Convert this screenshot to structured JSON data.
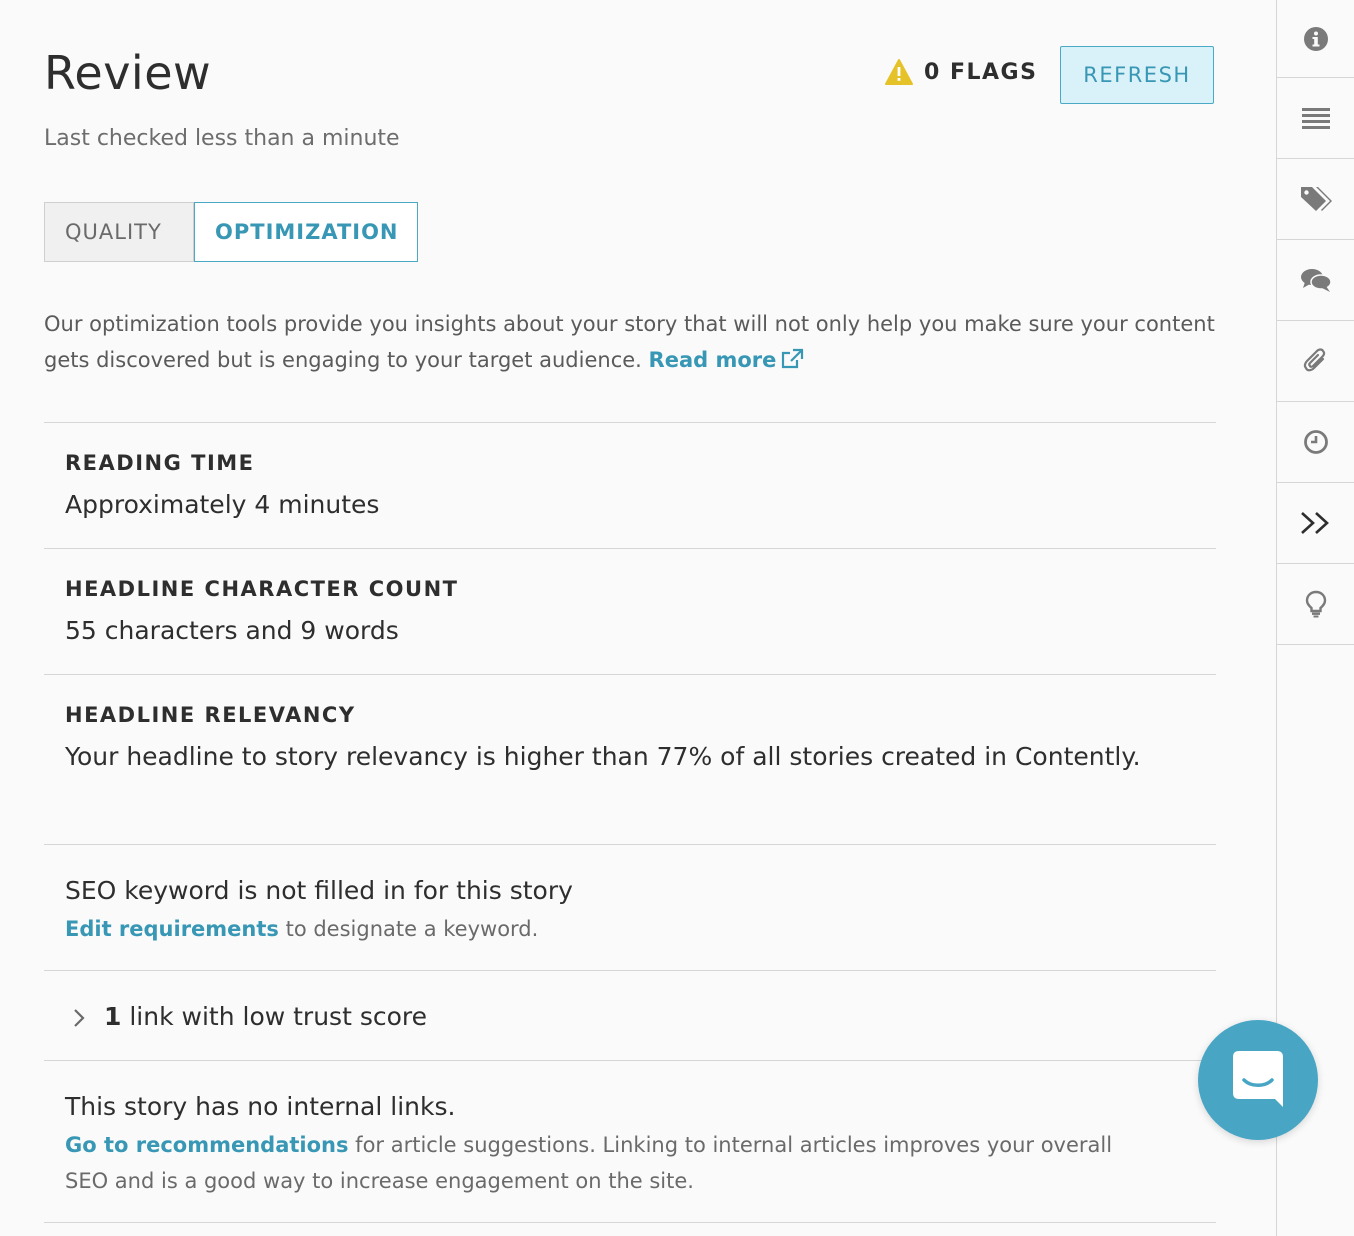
{
  "header": {
    "title": "Review",
    "subtitle": "Last checked less than a minute",
    "flags_label": "0 FLAGS",
    "refresh_label": "REFRESH"
  },
  "tabs": [
    {
      "label": "QUALITY",
      "active": false
    },
    {
      "label": "OPTIMIZATION",
      "active": true
    }
  ],
  "intro": {
    "text": "Our optimization tools provide you insights about your story that will not only help you make sure your content gets discovered but is engaging to your target audience. ",
    "link": "Read more"
  },
  "sections": {
    "reading_time": {
      "label": "READING TIME",
      "value": "Approximately 4 minutes"
    },
    "headline_count": {
      "label": "HEADLINE CHARACTER COUNT",
      "value": "55 characters and 9 words"
    },
    "headline_relevancy": {
      "label": "HEADLINE RELEVANCY",
      "value": "Your headline to story relevancy is higher than 77% of all stories created in Contently."
    },
    "seo": {
      "title": "SEO keyword is not filled in for this story",
      "link": "Edit requirements",
      "text": " to designate a keyword."
    },
    "trust": {
      "count": "1",
      "text": " link with low trust score"
    },
    "internal_links": {
      "title": "This story has no internal links.",
      "link": "Go to recommendations",
      "text": " for article suggestions. Linking to internal articles improves your overall SEO and is a good way to increase engagement on the site."
    }
  },
  "sidebar": {
    "items": [
      "info-icon",
      "list-icon",
      "tags-icon",
      "comments-icon",
      "paperclip-icon",
      "clock-icon",
      "collapse-icon",
      "lightbulb-icon"
    ]
  },
  "colors": {
    "accent": "#3797b4",
    "warning": "#e6c229",
    "chat": "#48a6c4"
  }
}
